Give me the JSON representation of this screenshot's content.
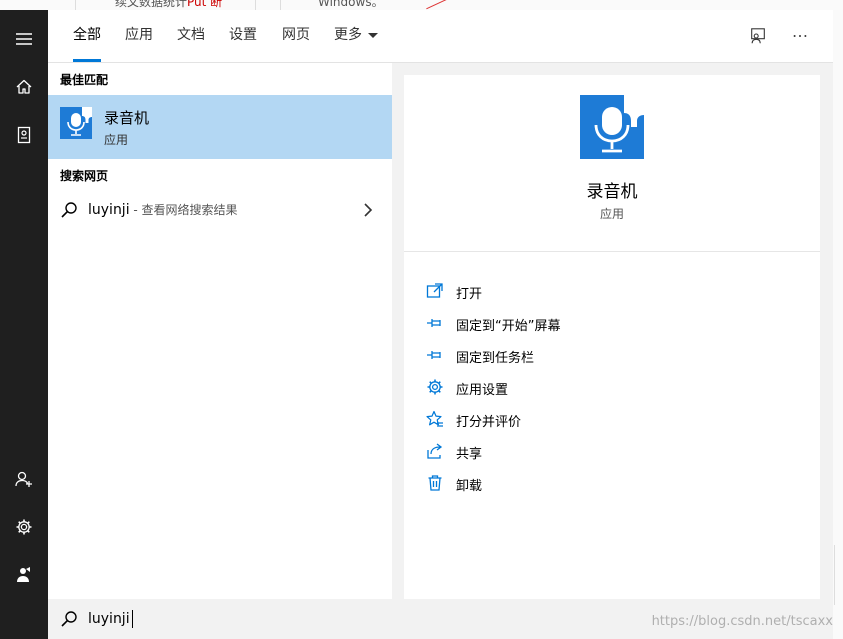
{
  "background": {
    "text1": "续文数据统计",
    "text1_red": "Put 断",
    "text2": "Windows。"
  },
  "tabs": [
    {
      "label": "全部"
    },
    {
      "label": "应用"
    },
    {
      "label": "文档"
    },
    {
      "label": "设置"
    },
    {
      "label": "网页"
    },
    {
      "label": "更多"
    }
  ],
  "results": {
    "best_match_label": "最佳匹配",
    "best_match": {
      "name": "录音机",
      "type": "应用"
    },
    "web_label": "搜索网页",
    "web_query": "luyinji",
    "web_hint": " - 查看网络搜索结果"
  },
  "details": {
    "name": "录音机",
    "type": "应用",
    "actions": [
      {
        "label": "打开",
        "icon": "open-icon"
      },
      {
        "label": "固定到“开始”屏幕",
        "icon": "pin-icon"
      },
      {
        "label": "固定到任务栏",
        "icon": "pin-icon"
      },
      {
        "label": "应用设置",
        "icon": "gear-icon"
      },
      {
        "label": "打分并评价",
        "icon": "star-icon"
      },
      {
        "label": "共享",
        "icon": "share-icon"
      },
      {
        "label": "卸载",
        "icon": "trash-icon"
      }
    ]
  },
  "search": {
    "value": "luyinji"
  },
  "watermark": "https://blog.csdn.net/tscaxx",
  "colors": {
    "accent": "#0078d7",
    "selected": "#b3d7f3",
    "rail": "#1f1f1f",
    "app_icon": "#1e7bd6"
  }
}
